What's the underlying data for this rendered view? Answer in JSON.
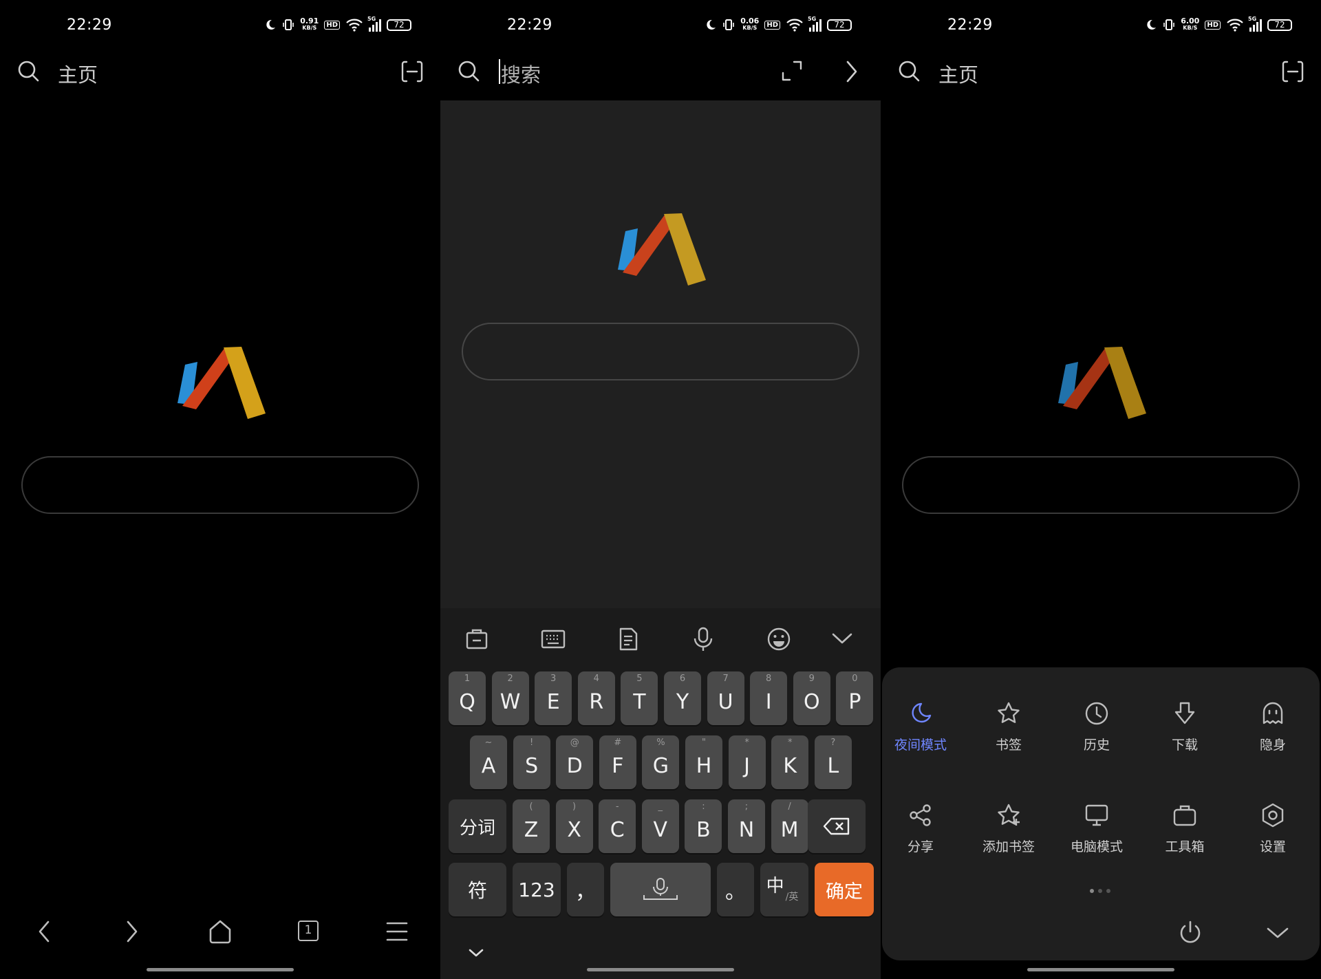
{
  "status_bar": {
    "time": "22:29",
    "net_speeds": [
      "0.91",
      "0.06",
      "6.00"
    ],
    "net_unit": "KB/S",
    "hd_label": "HD",
    "signal_label": "5G",
    "battery": "72"
  },
  "screen1": {
    "title": "主页",
    "icons": [
      "search-icon",
      "scan-icon",
      "back-icon",
      "forward-icon",
      "home-icon",
      "tabs-icon",
      "menu-icon"
    ],
    "tab_count": "1"
  },
  "screen2": {
    "search_placeholder": "搜索",
    "toolbar_icons": [
      "clipboard-icon",
      "keyboard-icon",
      "notes-icon",
      "mic-icon",
      "emoji-icon",
      "collapse-icon"
    ],
    "rows": [
      {
        "keys": [
          "Q",
          "W",
          "E",
          "R",
          "T",
          "Y",
          "U",
          "I",
          "O",
          "P"
        ],
        "hints": [
          "1",
          "2",
          "3",
          "4",
          "5",
          "6",
          "7",
          "8",
          "9",
          "0"
        ]
      },
      {
        "keys": [
          "A",
          "S",
          "D",
          "F",
          "G",
          "H",
          "J",
          "K",
          "L"
        ],
        "hints": [
          "~",
          "!",
          "@",
          "#",
          "%",
          "\"",
          "*",
          "*",
          "?"
        ]
      },
      {
        "keys": [
          "Z",
          "X",
          "C",
          "V",
          "B",
          "N",
          "M"
        ],
        "hints": [
          "(",
          ")",
          "-",
          "_",
          ":",
          ";",
          "/"
        ]
      }
    ],
    "segment_key": "分词",
    "symbol_key": "符",
    "num_key": "123",
    "comma_key": "，",
    "period_key": "。",
    "lang_key_main": "中",
    "lang_key_sub": "/英",
    "confirm_key": "确定",
    "accent_color": "#e86a28"
  },
  "screen3": {
    "title": "主页",
    "menu_items": [
      {
        "label": "夜间模式",
        "icon": "moon-icon",
        "active": true
      },
      {
        "label": "书签",
        "icon": "star-icon"
      },
      {
        "label": "历史",
        "icon": "clock-icon"
      },
      {
        "label": "下载",
        "icon": "download-icon"
      },
      {
        "label": "隐身",
        "icon": "ghost-icon"
      },
      {
        "label": "分享",
        "icon": "share-icon"
      },
      {
        "label": "添加书签",
        "icon": "add-bookmark-icon"
      },
      {
        "label": "电脑模式",
        "icon": "desktop-icon"
      },
      {
        "label": "工具箱",
        "icon": "toolbox-icon"
      },
      {
        "label": "设置",
        "icon": "settings-icon"
      }
    ],
    "active_color": "#6f86ff"
  }
}
